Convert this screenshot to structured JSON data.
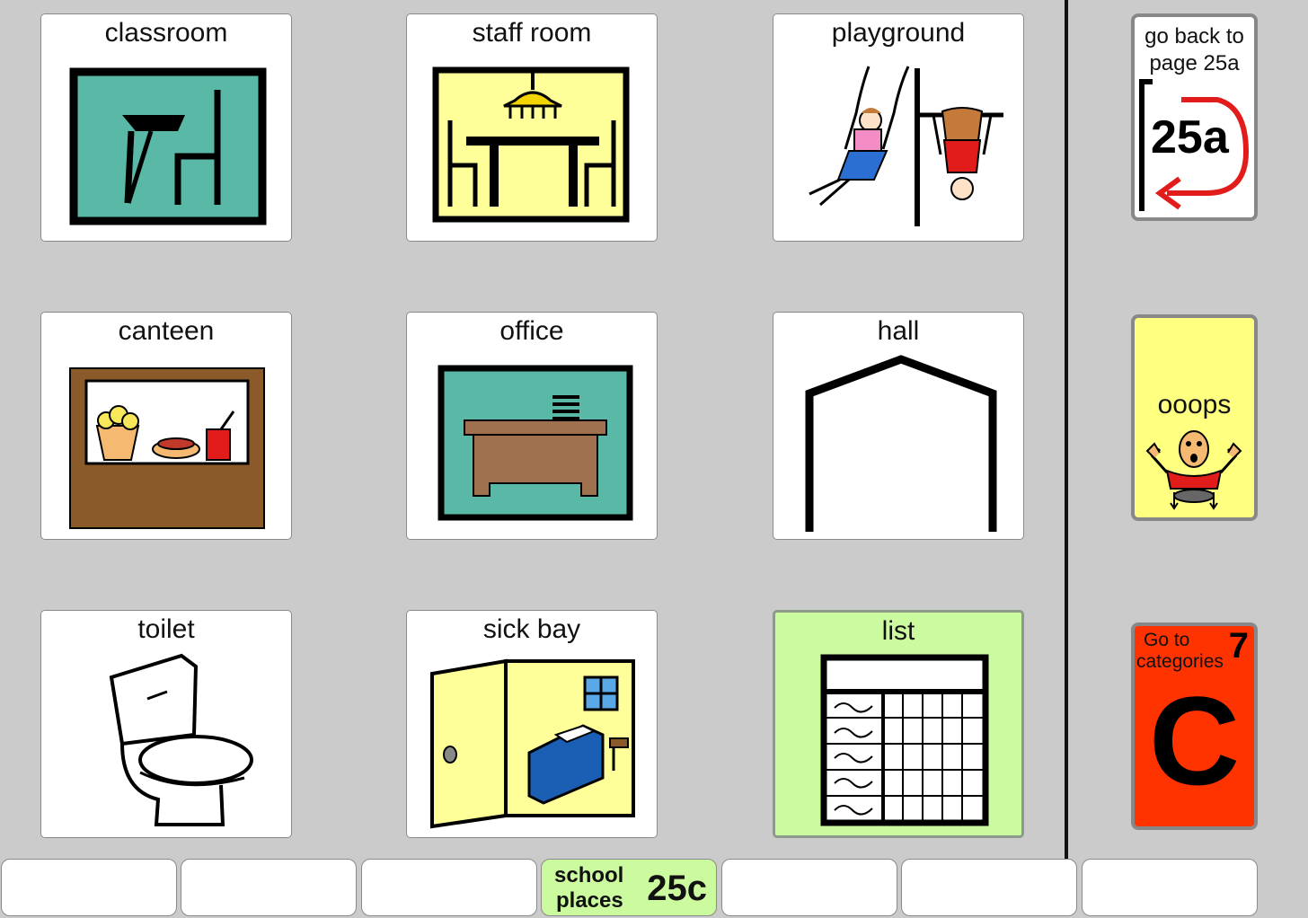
{
  "grid": [
    {
      "label": "classroom",
      "icon": "classroom-icon"
    },
    {
      "label": "staff room",
      "icon": "staff-room-icon"
    },
    {
      "label": "playground",
      "icon": "playground-icon"
    },
    {
      "label": "canteen",
      "icon": "canteen-icon"
    },
    {
      "label": "office",
      "icon": "office-icon"
    },
    {
      "label": "hall",
      "icon": "hall-icon"
    },
    {
      "label": "toilet",
      "icon": "toilet-icon"
    },
    {
      "label": "sick bay",
      "icon": "sick-bay-icon"
    },
    {
      "label": "list",
      "icon": "list-icon"
    }
  ],
  "side": {
    "back": {
      "line1": "go back to",
      "line2": "page 25a",
      "page": "25a",
      "icon": "return-arrow-icon"
    },
    "oops": {
      "label": "ooops",
      "icon": "oops-person-icon"
    },
    "categories": {
      "line1": "Go to",
      "line2": "categories",
      "number": "7",
      "letter": "C"
    }
  },
  "bottom": {
    "current": {
      "line1": "school",
      "line2": "places",
      "page": "25c"
    }
  },
  "colors": {
    "background": "#cbcbcb",
    "list_green": "#ccfa9e",
    "oops_yellow": "#ffff80",
    "categories_red": "#ff3300",
    "teal": "#5ab8a6",
    "pale_yellow": "#ffff99"
  }
}
